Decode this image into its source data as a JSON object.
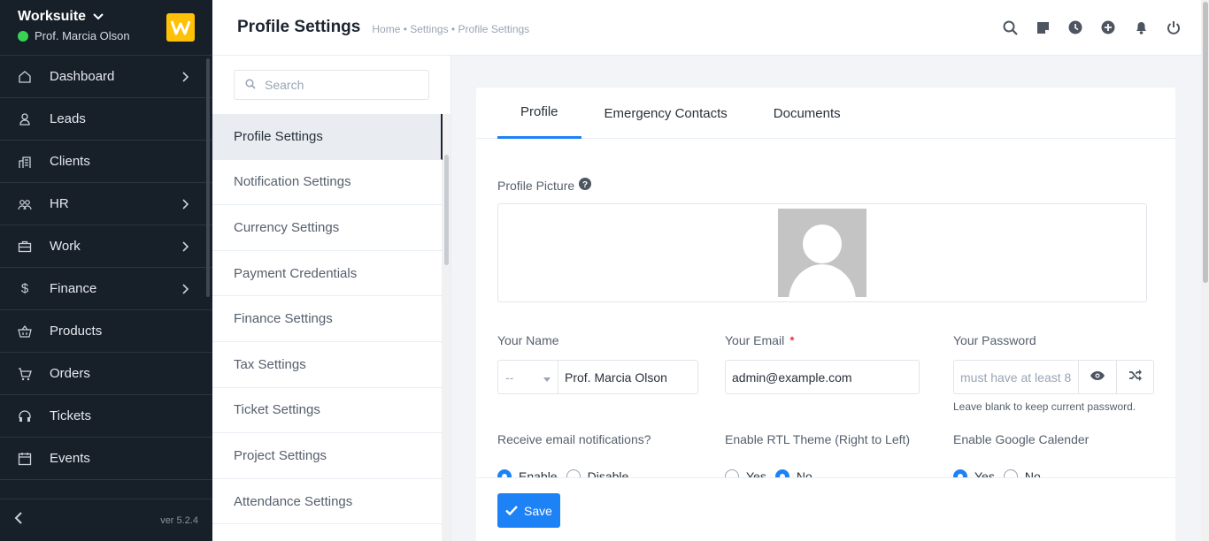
{
  "sidebar": {
    "brand": "Worksuite",
    "user": "Prof. Marcia Olson",
    "items": [
      {
        "label": "Dashboard",
        "icon": "house-icon",
        "arrow": true
      },
      {
        "label": "Leads",
        "icon": "user-icon",
        "arrow": false
      },
      {
        "label": "Clients",
        "icon": "building-icon",
        "arrow": false
      },
      {
        "label": "HR",
        "icon": "users-icon",
        "arrow": true
      },
      {
        "label": "Work",
        "icon": "briefcase-icon",
        "arrow": true
      },
      {
        "label": "Finance",
        "icon": "dollar-icon",
        "arrow": true
      },
      {
        "label": "Products",
        "icon": "basket-icon",
        "arrow": false
      },
      {
        "label": "Orders",
        "icon": "cart-icon",
        "arrow": false
      },
      {
        "label": "Tickets",
        "icon": "headset-icon",
        "arrow": false
      },
      {
        "label": "Events",
        "icon": "calendar-icon",
        "arrow": false
      }
    ],
    "version": "ver 5.2.4"
  },
  "header": {
    "title": "Profile Settings",
    "breadcrumb": "Home • Settings • Profile Settings"
  },
  "settings_menu": {
    "search_placeholder": "Search",
    "items": [
      "Profile Settings",
      "Notification Settings",
      "Currency Settings",
      "Payment Credentials",
      "Finance Settings",
      "Tax Settings",
      "Ticket Settings",
      "Project Settings",
      "Attendance Settings"
    ]
  },
  "tabs": [
    "Profile",
    "Emergency Contacts",
    "Documents"
  ],
  "form": {
    "picture_label": "Profile Picture",
    "name_label": "Your Name",
    "salutation": "--",
    "name_value": "Prof. Marcia Olson",
    "email_label": "Your Email",
    "required_mark": "*",
    "email_value": "admin@example.com",
    "password_label": "Your Password",
    "password_placeholder": "must have at least 8",
    "password_help": "Leave blank to keep current password.",
    "email_notif_label": "Receive email notifications?",
    "email_notif_options": [
      "Enable",
      "Disable"
    ],
    "rtl_label": "Enable RTL Theme (Right to Left)",
    "rtl_options": [
      "Yes",
      "No"
    ],
    "gcal_label": "Enable Google Calender",
    "gcal_options": [
      "Yes",
      "No"
    ],
    "save_label": "Save"
  },
  "colors": {
    "accent": "#1d82f5",
    "sidebar": "#171f29",
    "logo": "#ffc107",
    "online": "#39d353"
  }
}
